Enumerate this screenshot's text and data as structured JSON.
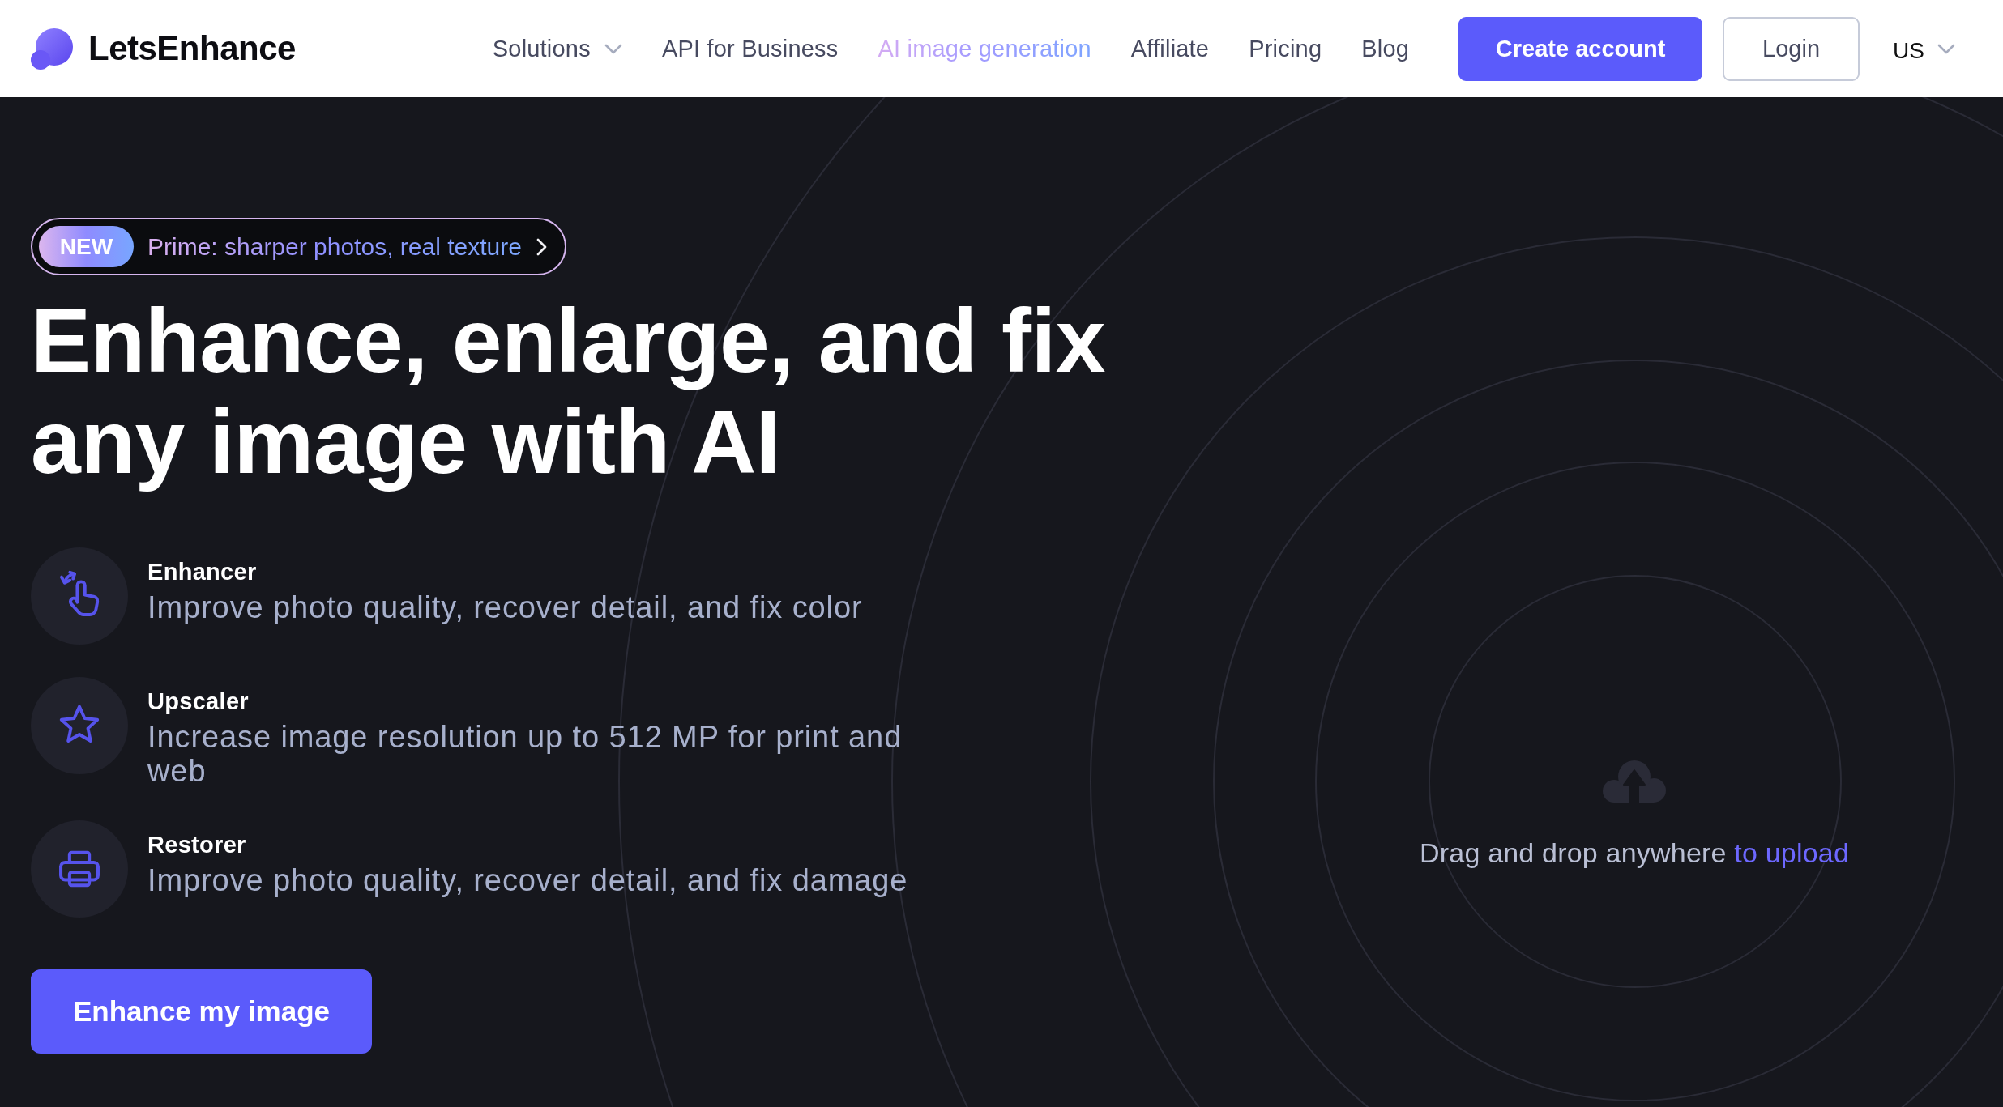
{
  "header": {
    "brand": "LetsEnhance",
    "nav": [
      {
        "label": "Solutions",
        "kind": "dropdown"
      },
      {
        "label": "API for Business",
        "kind": "link"
      },
      {
        "label": "AI image generation",
        "kind": "highlight"
      },
      {
        "label": "Affiliate",
        "kind": "link"
      },
      {
        "label": "Pricing",
        "kind": "link"
      },
      {
        "label": "Blog",
        "kind": "link"
      }
    ],
    "actions": [
      {
        "label": "Create account",
        "kind": "primary"
      },
      {
        "label": "Login",
        "kind": "outline"
      }
    ],
    "region": "US"
  },
  "hero": {
    "badge": {
      "tag": "NEW",
      "text": "Prime: sharper photos, real texture"
    },
    "heading": "Enhance, enlarge, and fix any image with AI",
    "features": [
      {
        "kind": "tap",
        "title": "Enhancer",
        "description": "Improve photo quality, recover detail, and fix color"
      },
      {
        "kind": "star",
        "title": "Upscaler",
        "description": "Increase image resolution up to 512 MP for print and web"
      },
      {
        "kind": "printer",
        "title": "Restorer",
        "description": "Improve photo quality, recover detail, and fix damage"
      }
    ],
    "cta": "Enhance my image"
  },
  "upload": {
    "text": "Drag and drop anywhere",
    "link": "to upload"
  }
}
